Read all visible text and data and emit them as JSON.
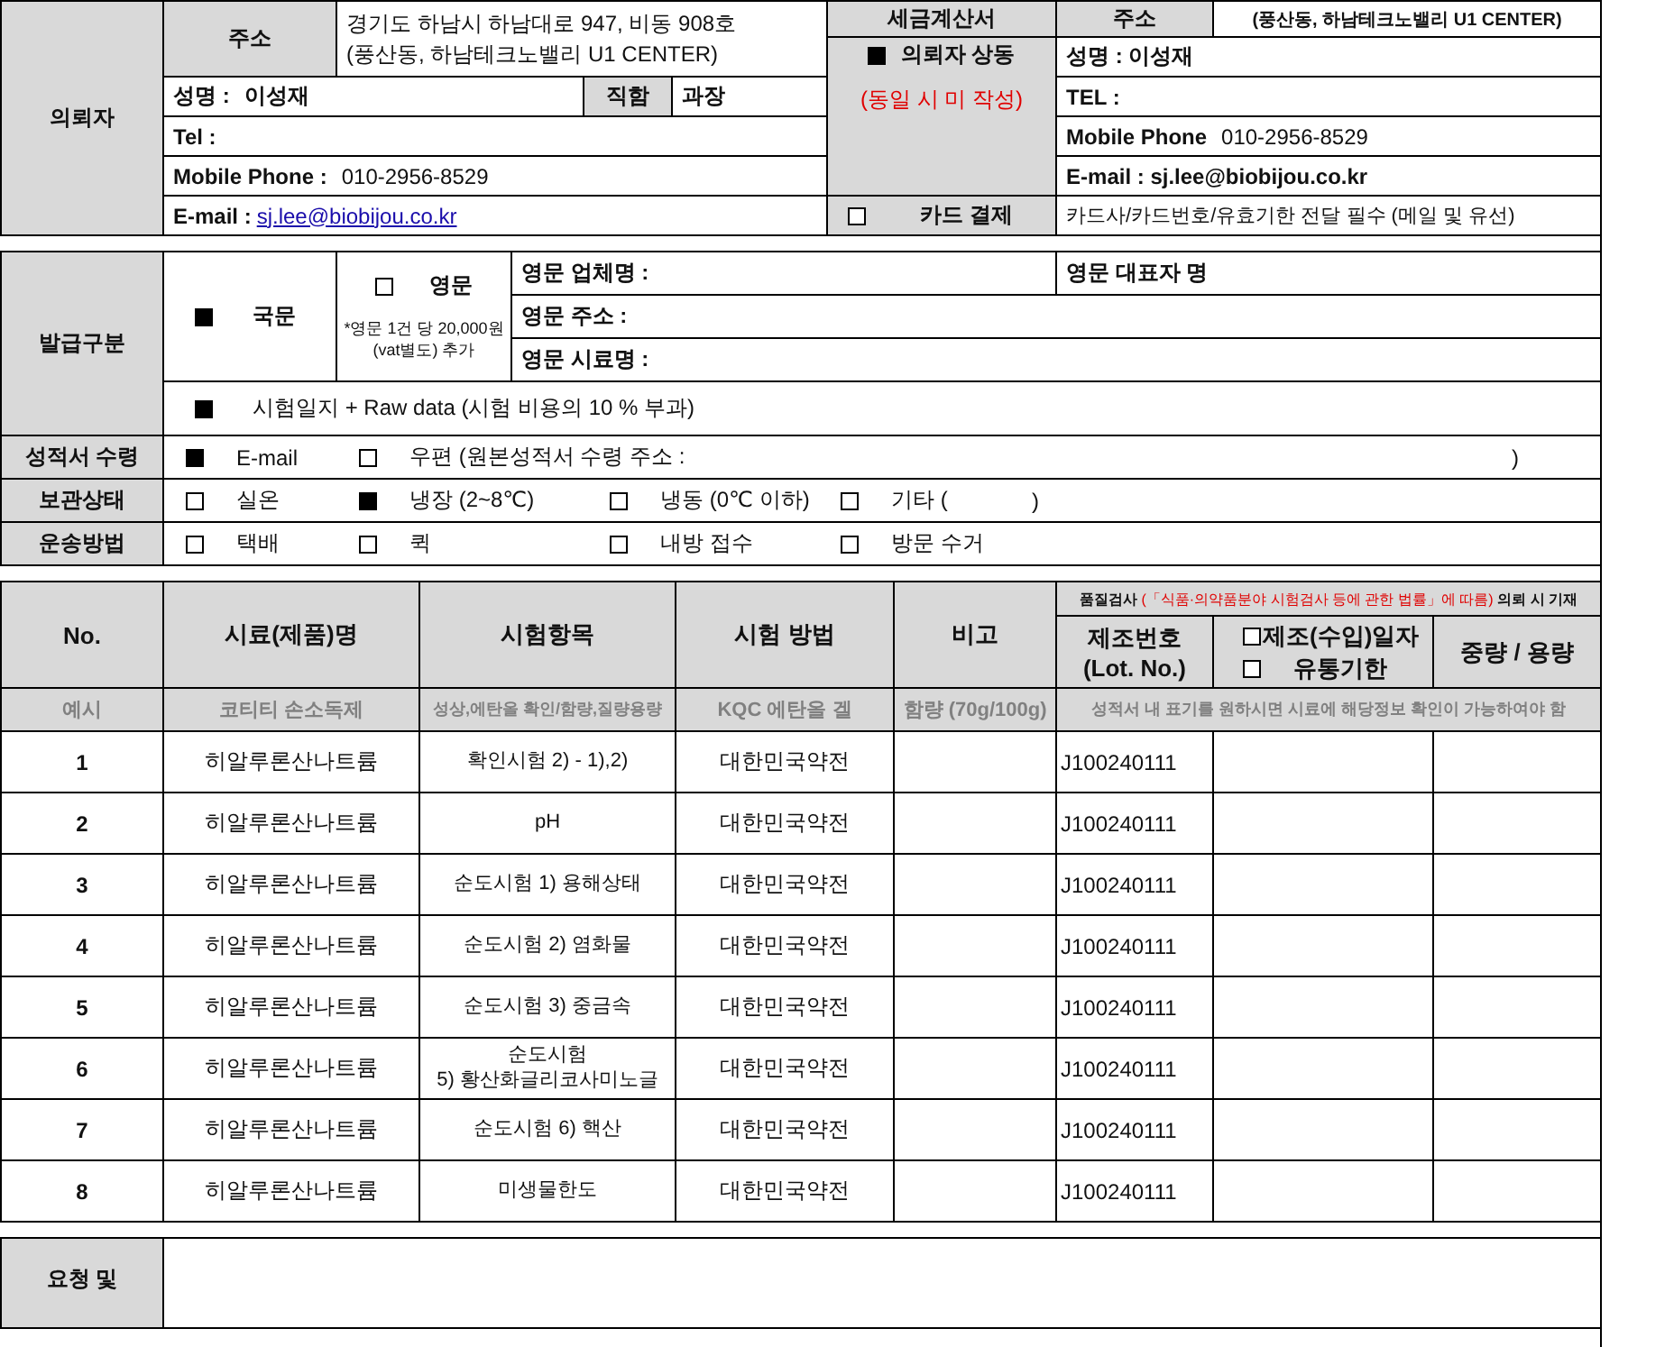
{
  "requester": {
    "label": "의뢰자",
    "address_label": "주소",
    "address_lines": [
      "경기도 하남시 하남대로 947, 비동 908호",
      "(풍산동, 하남테크노밸리 U1 CENTER)"
    ],
    "name_label": "성명 :",
    "name": "이성재",
    "title_label": "직함",
    "title": "과장",
    "tel_label": "Tel :",
    "mobile_label": "Mobile Phone :",
    "mobile": "010-2956-8529",
    "email_label": "E-mail :",
    "email": "sj.lee@biobijou.co.kr"
  },
  "invoice": {
    "label": "세금계산서",
    "same": {
      "label": "의뢰자 상동",
      "checked": true
    },
    "note": "(동일 시 미 작성)",
    "card": {
      "label": "카드 결제",
      "checked": false
    },
    "card_note": "카드사/카드번호/유효기한 전달 필수 (메일 및 유선)",
    "address_label": "주소",
    "address": "(풍산동, 하남테크노밸리 U1 CENTER)",
    "name": "성명 : 이성재",
    "tel": "TEL :",
    "mobile_label": "Mobile Phone",
    "mobile": "010-2956-8529",
    "email": "E-mail : sj.lee@biobijou.co.kr"
  },
  "issue": {
    "label": "발급구분",
    "korean": {
      "label": "국문",
      "checked": true
    },
    "english": {
      "label": "영문",
      "checked": false
    },
    "english_note": "*영문 1건 당 20,000원 (vat별도) 추가",
    "fields": [
      "영문 업체명 :",
      "영문 주소 :",
      "영문 시료명 :"
    ],
    "representative_label": "영문 대표자 명",
    "raw_data": {
      "label": "시험일지 + Raw data (시험 비용의 10 % 부과)",
      "checked": true
    }
  },
  "option_rows": [
    {
      "label": "성적서 수령",
      "options": [
        {
          "label": "E-mail",
          "checked": true
        },
        {
          "label": "우편 (원본성적서 수령 주소 :",
          "checked": false,
          "suffix": ")"
        }
      ]
    },
    {
      "label": "보관상태",
      "options": [
        {
          "label": "실온",
          "checked": false
        },
        {
          "label": "냉장 (2~8℃)",
          "checked": true
        },
        {
          "label": "냉동 (0℃ 이하)",
          "checked": false
        },
        {
          "label": "기타 (",
          "checked": false,
          "suffix": ")"
        }
      ]
    },
    {
      "label": "운송방법",
      "options": [
        {
          "label": "택배",
          "checked": false
        },
        {
          "label": "퀵",
          "checked": false
        },
        {
          "label": "내방 접수",
          "checked": false
        },
        {
          "label": "방문 수거",
          "checked": false
        }
      ]
    }
  ],
  "table": {
    "columns": [
      "No.",
      "시료(제품)명",
      "시험항목",
      "시험 방법",
      "비고"
    ],
    "quality_note": {
      "before": "품질검사",
      "highlight": "(「식품·의약품분야 시험검사 등에 관한 법률」에 따름)",
      "after": "의뢰 시 기재"
    },
    "lot_header": "제조번호\n(Lot. No.)",
    "date_options": [
      {
        "label": "제조(수입)일자",
        "checked": false
      },
      {
        "label": "유통기한",
        "checked": false
      }
    ],
    "weight_header": "중량 / 용량",
    "example": {
      "no": "예시",
      "sample": "코티티 손소독제",
      "test_item": "성상,에탄올 확인/함량,질량용량",
      "method": "KQC 에탄올 겔",
      "remark": "함량 (70g/100g)",
      "note": "성적서 내 표기를 원하시면 시료에 해당정보 확인이 가능하여야 함"
    },
    "rows": [
      {
        "no": "1",
        "sample": "히알루론산나트륨",
        "test_item": "확인시험 2) - 1),2)",
        "method": "대한민국약전",
        "lot": "J100240111"
      },
      {
        "no": "2",
        "sample": "히알루론산나트륨",
        "test_item": "pH",
        "method": "대한민국약전",
        "lot": "J100240111"
      },
      {
        "no": "3",
        "sample": "히알루론산나트륨",
        "test_item": "순도시험 1) 용해상태",
        "method": "대한민국약전",
        "lot": "J100240111"
      },
      {
        "no": "4",
        "sample": "히알루론산나트륨",
        "test_item": "순도시험 2) 염화물",
        "method": "대한민국약전",
        "lot": "J100240111"
      },
      {
        "no": "5",
        "sample": "히알루론산나트륨",
        "test_item": "순도시험 3) 중금속",
        "method": "대한민국약전",
        "lot": "J100240111"
      },
      {
        "no": "6",
        "sample": "히알루론산나트륨",
        "test_item": "순도시험\n5) 황산화글리코사미노글",
        "method": "대한민국약전",
        "lot": "J100240111"
      },
      {
        "no": "7",
        "sample": "히알루론산나트륨",
        "test_item": "순도시험 6) 핵산",
        "method": "대한민국약전",
        "lot": "J100240111"
      },
      {
        "no": "8",
        "sample": "히알루론산나트륨",
        "test_item": "미생물한도",
        "method": "대한민국약전",
        "lot": "J100240111"
      }
    ]
  },
  "request": {
    "label": "요청 및"
  }
}
